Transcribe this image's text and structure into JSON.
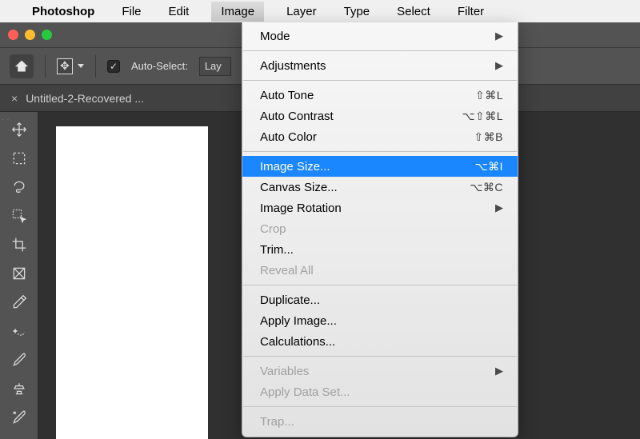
{
  "menubar": {
    "app_name": "Photoshop",
    "items": [
      "File",
      "Edit",
      "Image",
      "Layer",
      "Type",
      "Select",
      "Filter"
    ],
    "open_index": 2
  },
  "options_bar": {
    "auto_select_label": "Auto-Select:",
    "layer_selector_value": "Lay"
  },
  "document": {
    "tab_title": "Untitled-2-Recovered ..."
  },
  "image_menu": {
    "groups": [
      [
        {
          "label": "Mode",
          "submenu": true
        }
      ],
      [
        {
          "label": "Adjustments",
          "submenu": true
        }
      ],
      [
        {
          "label": "Auto Tone",
          "shortcut": "⇧⌘L"
        },
        {
          "label": "Auto Contrast",
          "shortcut": "⌥⇧⌘L"
        },
        {
          "label": "Auto Color",
          "shortcut": "⇧⌘B"
        }
      ],
      [
        {
          "label": "Image Size...",
          "shortcut": "⌥⌘I",
          "highlight": true
        },
        {
          "label": "Canvas Size...",
          "shortcut": "⌥⌘C"
        },
        {
          "label": "Image Rotation",
          "submenu": true
        },
        {
          "label": "Crop",
          "disabled": true
        },
        {
          "label": "Trim..."
        },
        {
          "label": "Reveal All",
          "disabled": true
        }
      ],
      [
        {
          "label": "Duplicate..."
        },
        {
          "label": "Apply Image..."
        },
        {
          "label": "Calculations..."
        }
      ],
      [
        {
          "label": "Variables",
          "submenu": true,
          "disabled": true
        },
        {
          "label": "Apply Data Set...",
          "disabled": true
        }
      ],
      [
        {
          "label": "Trap...",
          "disabled": true
        }
      ]
    ]
  },
  "tools": [
    {
      "name": "move-tool"
    },
    {
      "name": "marquee-tool"
    },
    {
      "name": "lasso-tool"
    },
    {
      "name": "quick-select-tool"
    },
    {
      "name": "crop-tool"
    },
    {
      "name": "frame-tool"
    },
    {
      "name": "eyedropper-tool"
    },
    {
      "name": "healing-brush-tool"
    },
    {
      "name": "brush-tool"
    },
    {
      "name": "clone-stamp-tool"
    },
    {
      "name": "history-brush-tool"
    }
  ]
}
